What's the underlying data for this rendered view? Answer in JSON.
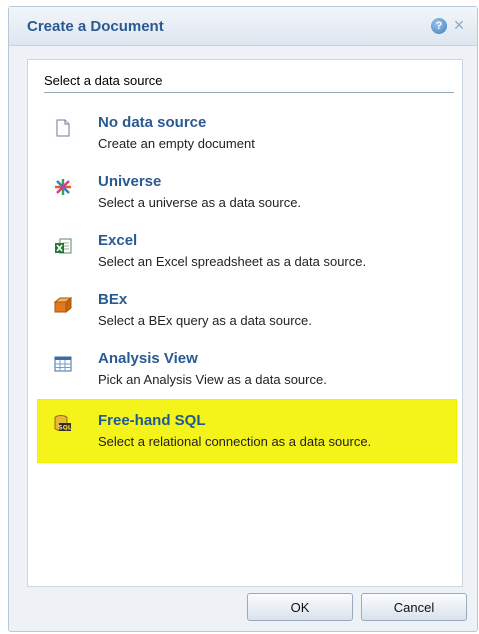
{
  "dialog": {
    "title": "Create a Document",
    "help_icon": "question-icon",
    "close_icon": "close-icon",
    "close_glyph": "×",
    "help_glyph": "?"
  },
  "panel": {
    "header": "Select a data source",
    "options": [
      {
        "name": "No data source",
        "description": "Create an empty document",
        "icon": "blank-document-icon",
        "highlighted": false
      },
      {
        "name": "Universe",
        "description": "Select a universe as a data source.",
        "icon": "universe-icon",
        "highlighted": false
      },
      {
        "name": "Excel",
        "description": "Select an Excel spreadsheet as a data source.",
        "icon": "excel-icon",
        "highlighted": false
      },
      {
        "name": "BEx",
        "description": "Select a BEx query as a data source.",
        "icon": "bex-icon",
        "highlighted": false
      },
      {
        "name": "Analysis View",
        "description": "Pick an Analysis View as a data source.",
        "icon": "analysis-view-icon",
        "highlighted": false
      },
      {
        "name": "Free-hand SQL",
        "description": "Select a relational connection as a data source.",
        "icon": "sql-icon",
        "highlighted": true
      }
    ]
  },
  "footer": {
    "ok_label": "OK",
    "cancel_label": "Cancel"
  },
  "colors": {
    "title": "#2a5a92",
    "highlight": "#f4f41a"
  }
}
